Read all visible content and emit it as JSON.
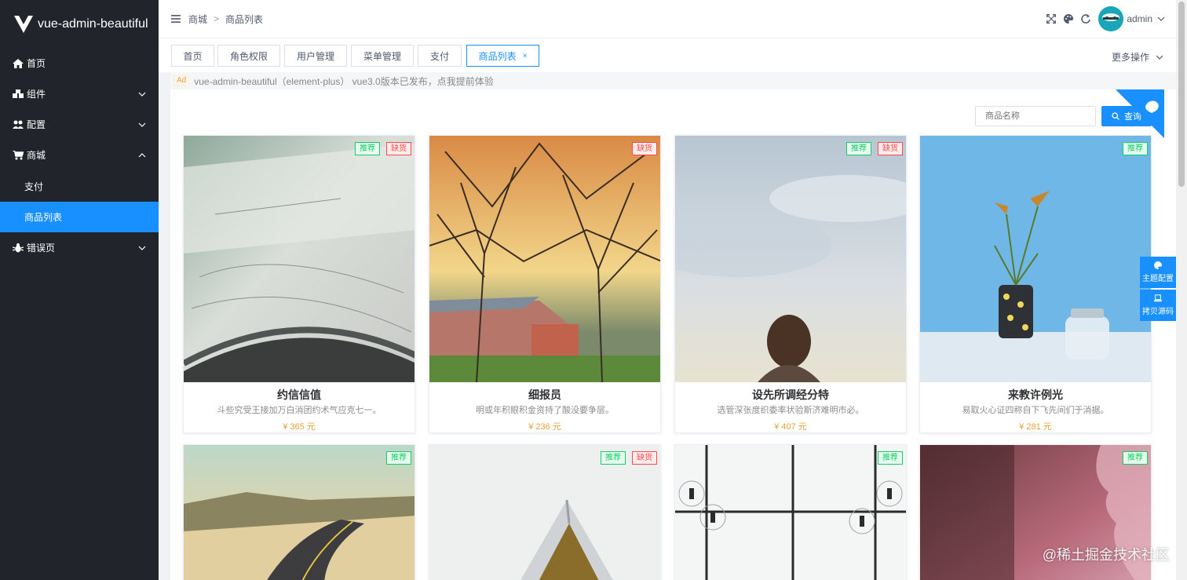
{
  "sidebar": {
    "logo_text": "vue-admin-beautiful",
    "items": [
      {
        "label": "首页",
        "icon": "home-icon"
      },
      {
        "label": "组件",
        "icon": "cubes-icon"
      },
      {
        "label": "配置",
        "icon": "users-cog-icon"
      },
      {
        "label": "商城",
        "icon": "cart-icon"
      },
      {
        "label": "支付",
        "icon": ""
      },
      {
        "label": "商品列表",
        "icon": ""
      },
      {
        "label": "错误页",
        "icon": "bug-icon"
      }
    ]
  },
  "header": {
    "breadcrumb": [
      "商城",
      "商品列表"
    ],
    "breadcrumb_sep": ">",
    "username": "admin"
  },
  "tabs": [
    {
      "label": "首页"
    },
    {
      "label": "角色权限"
    },
    {
      "label": "用户管理"
    },
    {
      "label": "菜单管理"
    },
    {
      "label": "支付"
    },
    {
      "label": "商品列表",
      "active": true
    }
  ],
  "tab_close": "×",
  "more_ops": "更多操作",
  "ad": {
    "tag": "Ad",
    "text": "vue-admin-beautiful（element-plus） vue3.0版本已发布，点我提前体验"
  },
  "search": {
    "placeholder": "商品名称",
    "button": "查询"
  },
  "products": [
    {
      "title": "约信信值",
      "desc": "斗些究受王接加万白消团约术气应克七一。",
      "price": "¥ 365 元",
      "badges": [
        "推荐",
        "缺货"
      ]
    },
    {
      "title": "细报员",
      "desc": "明或年积眼积金资持了酸没要争层。",
      "price": "¥ 236 元",
      "badges": [
        "缺货"
      ]
    },
    {
      "title": "设先所调经分特",
      "desc": "选管深张度织委率状验斯济难明市必。",
      "price": "¥ 407 元",
      "badges": [
        "推荐",
        "缺货"
      ]
    },
    {
      "title": "来教许例光",
      "desc": "易取火心证四称自下飞先间们于消据。",
      "price": "¥ 281 元",
      "badges": [
        "推荐"
      ]
    },
    {
      "badges": [
        "推荐"
      ]
    },
    {
      "badges": [
        "推荐",
        "缺货"
      ]
    },
    {
      "badges": [
        "推荐"
      ]
    },
    {
      "badges": [
        "推荐"
      ]
    }
  ],
  "float": {
    "theme": "主题配置",
    "copy": "拷贝源码"
  },
  "watermark": "@稀土掘金技术社区",
  "colors": {
    "primary": "#1890ff",
    "sidebar": "#21252b",
    "recommend": "#13ce66",
    "out_of_stock": "#ff4949",
    "price": "#e6a23c"
  }
}
